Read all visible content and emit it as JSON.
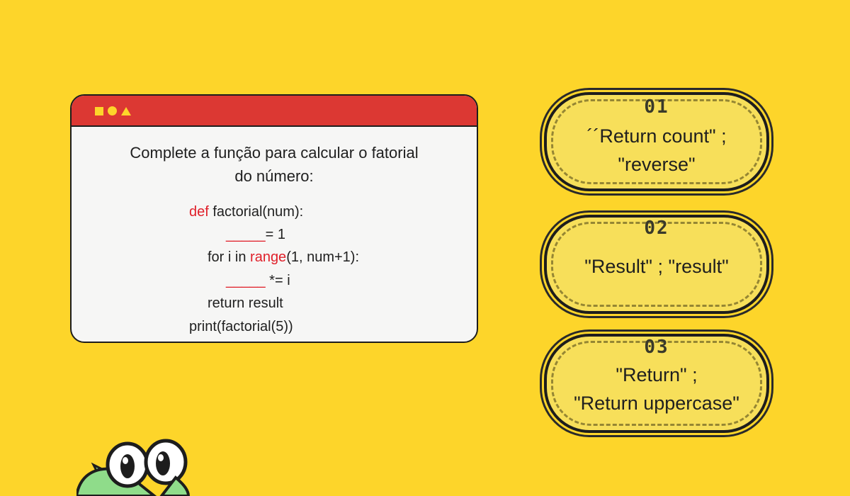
{
  "question": {
    "line1": "Complete a função para calcular o fatorial",
    "line2": "do número:"
  },
  "code": {
    "l1_kw": "def",
    "l1_rest": " factorial(num):",
    "l2_blank": "_____",
    "l2_rest": "= 1",
    "l3_pre": "for i in ",
    "l3_kw": "range",
    "l3_rest": "(1, num+1):",
    "l4_blank": "_____",
    "l4_rest": " *= i",
    "l5": "return result",
    "l6": "print(factorial(5))"
  },
  "options": [
    {
      "number": "01",
      "line1": "´´Return count\" ;",
      "line2": "\"reverse\""
    },
    {
      "number": "02",
      "line1": "\"Result\" ; \"result\"",
      "line2": ""
    },
    {
      "number": "03",
      "line1": "\"Return\" ;",
      "line2": "\"Return uppercase\""
    }
  ],
  "colors": {
    "background": "#fdd52a",
    "window_bar": "#dc3833",
    "keyword": "#e0202a",
    "option_fill": "#f7df5a",
    "mascot": "#8fdc8a"
  },
  "icons": [
    "square-icon",
    "circle-icon",
    "triangle-icon",
    "frog-mascot"
  ]
}
